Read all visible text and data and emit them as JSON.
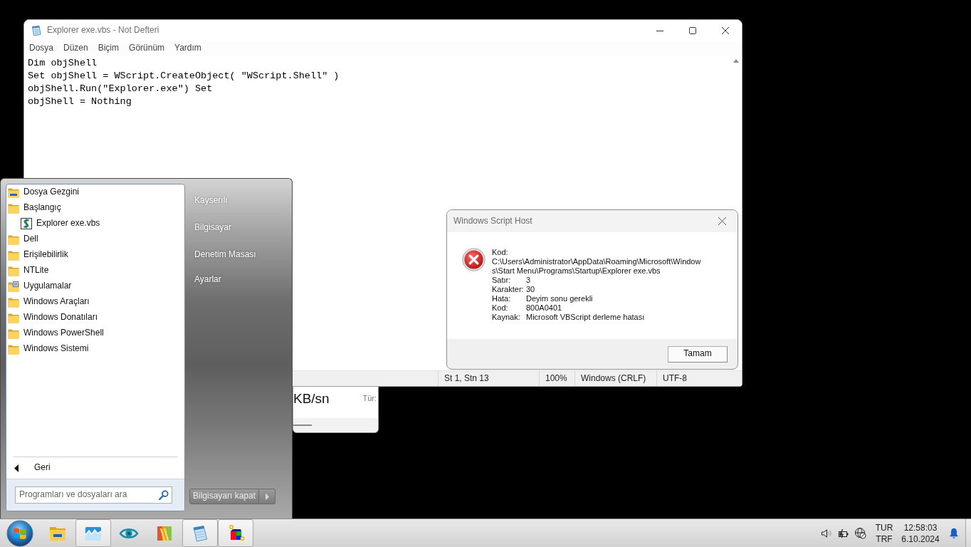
{
  "notepad": {
    "title": "Explorer exe.vbs - Not Defteri",
    "menu": [
      "Dosya",
      "Düzen",
      "Biçim",
      "Görünüm",
      "Yardım"
    ],
    "lines": [
      "Dim objShell",
      "Set objShell = WScript.CreateObject( \"WScript.Shell\" )",
      "objShell.Run(\"Explorer.exe\") Set",
      "objShell = Nothing"
    ],
    "status_bar": [
      "St 1, Stn 13",
      "100%",
      "Windows (CRLF)",
      "UTF-8"
    ]
  },
  "background_window": {
    "speed": "KB/sn",
    "label": "Tür:"
  },
  "start_menu": {
    "programs": [
      {
        "label": "Dosya Gezgini",
        "kind": "explorer"
      },
      {
        "label": "Başlangıç",
        "kind": "folder",
        "children": [
          {
            "label": "Explorer exe.vbs",
            "kind": "script"
          }
        ]
      },
      {
        "label": "Dell",
        "kind": "folder"
      },
      {
        "label": "Erişilebilirlik",
        "kind": "folder"
      },
      {
        "label": "NTLite",
        "kind": "folder"
      },
      {
        "label": "Uygulamalar",
        "kind": "apps"
      },
      {
        "label": "Windows Araçları",
        "kind": "folder"
      },
      {
        "label": "Windows Donatıları",
        "kind": "folder"
      },
      {
        "label": "Windows PowerShell",
        "kind": "folder"
      },
      {
        "label": "Windows Sistemi",
        "kind": "folder"
      }
    ],
    "back": "Geri",
    "search": {
      "placeholder": "Programları ve dosyaları ara"
    },
    "places": [
      {
        "label": "Kayserılı",
        "divider_below": true
      },
      {
        "label": "Bilgisayar",
        "divider_below": true
      },
      {
        "label": "Denetim Masası",
        "divider_below": false
      },
      {
        "label": "Ayarlar",
        "divider_below": false
      }
    ],
    "shutdown": "Bilgisayarı kapat"
  },
  "dialog": {
    "title": "Windows Script Host",
    "script_label": "Kod:",
    "script_path": "C:\\Users\\Administrator\\AppData\\Roaming\\Microsoft\\Windows\\Start Menu\\Programs\\Startup\\Explorer exe.vbs",
    "fields": [
      {
        "label": "Satır:",
        "value": "3"
      },
      {
        "label": "Karakter:",
        "value": "30"
      },
      {
        "label": "Hata:",
        "value": "Deyim sonu gerekli"
      },
      {
        "label": "Kod:",
        "value": "800A0401"
      },
      {
        "label": "Kaynak:",
        "value": "Microsoft VBScript derleme hatası"
      }
    ],
    "button": "Tamam"
  },
  "taskbar": {
    "items": [
      {
        "kind": "file-explorer",
        "running": false
      },
      {
        "kind": "photo-app",
        "running": true
      },
      {
        "kind": "eye-app",
        "running": false
      },
      {
        "kind": "color-app",
        "running": false
      },
      {
        "kind": "notepad",
        "running": true
      },
      {
        "kind": "cube-app",
        "running": true
      }
    ],
    "tray": {
      "language": "TUR",
      "layout": "TRF",
      "time": "12:58:03",
      "date": "6.10.2024"
    }
  }
}
